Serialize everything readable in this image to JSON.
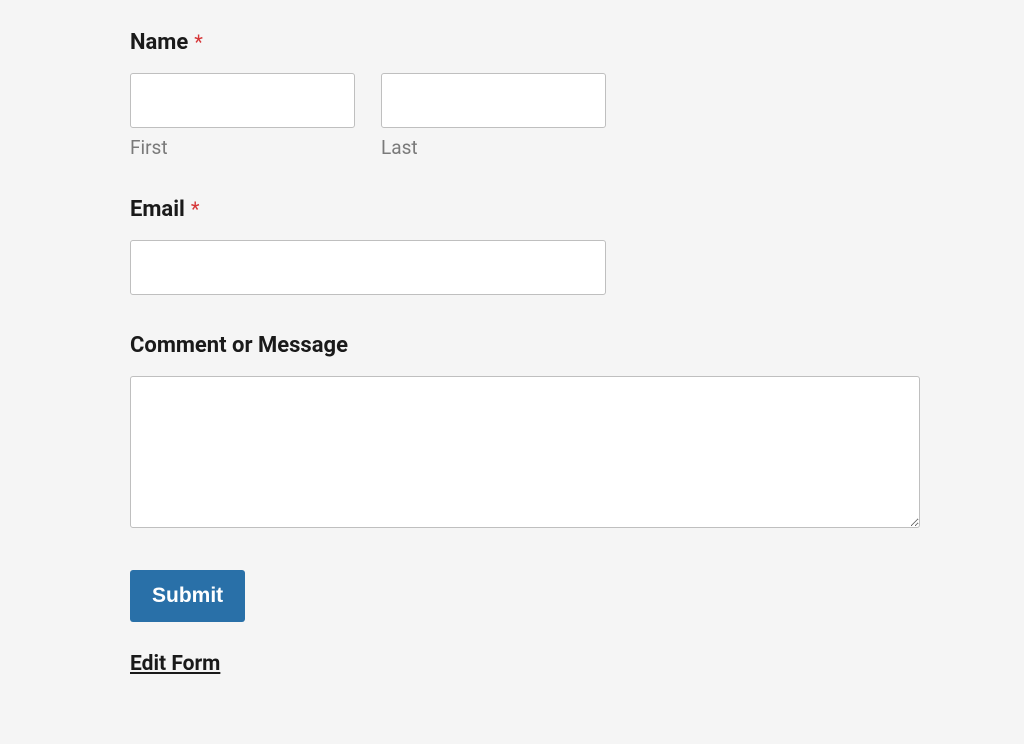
{
  "form": {
    "name": {
      "label": "Name",
      "required_symbol": "*",
      "first": {
        "sub_label": "First",
        "value": ""
      },
      "last": {
        "sub_label": "Last",
        "value": ""
      }
    },
    "email": {
      "label": "Email",
      "required_symbol": "*",
      "value": ""
    },
    "comment": {
      "label": "Comment or Message",
      "value": ""
    },
    "submit_label": "Submit",
    "edit_link_label": "Edit Form"
  }
}
